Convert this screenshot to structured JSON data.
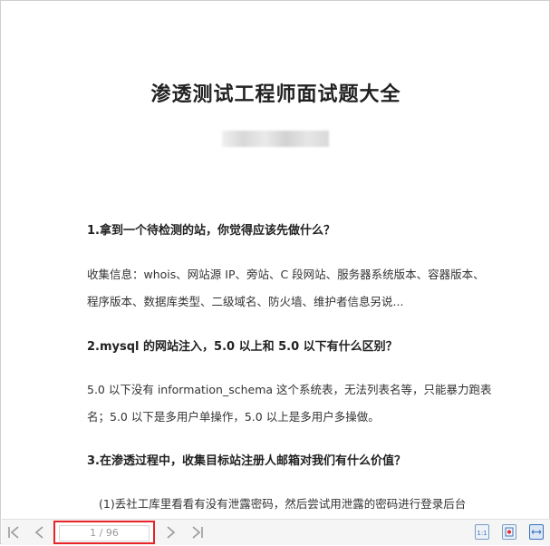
{
  "document": {
    "title": "渗透测试工程师面试题大全",
    "q1": "1.拿到一个待检测的站，你觉得应该先做什么？",
    "a1_line1": "收集信息：whois、网站源 IP、旁站、C 段网站、服务器系统版本、容器版本、",
    "a1_line2": "程序版本、数据库类型、二级域名、防火墙、维护者信息另说...",
    "q2": "2.mysql 的网站注入，5.0 以上和 5.0 以下有什么区别？",
    "a2_line1": "5.0 以下没有 information_schema 这个系统表，无法列表名等，只能暴力跑表",
    "a2_line2": "名；5.0 以下是多用户单操作，5.0 以上是多用户多操做。",
    "q3": "3.在渗透过程中，收集目标站注册人邮箱对我们有什么价值？",
    "a3_line1": "(1)丢社工库里看看有没有泄露密码，然后尝试用泄露的密码进行登录后台"
  },
  "toolbar": {
    "page_indicator": "1 / 96",
    "icons": [
      "first-page-icon",
      "prev-page-icon",
      "next-page-icon",
      "last-page-icon",
      "actual-size-icon",
      "fit-page-icon",
      "fit-width-icon"
    ]
  },
  "colors": {
    "highlight": "#e8232a",
    "icon_gray": "#9a9a9a",
    "accent_blue": "#3b73b9"
  }
}
